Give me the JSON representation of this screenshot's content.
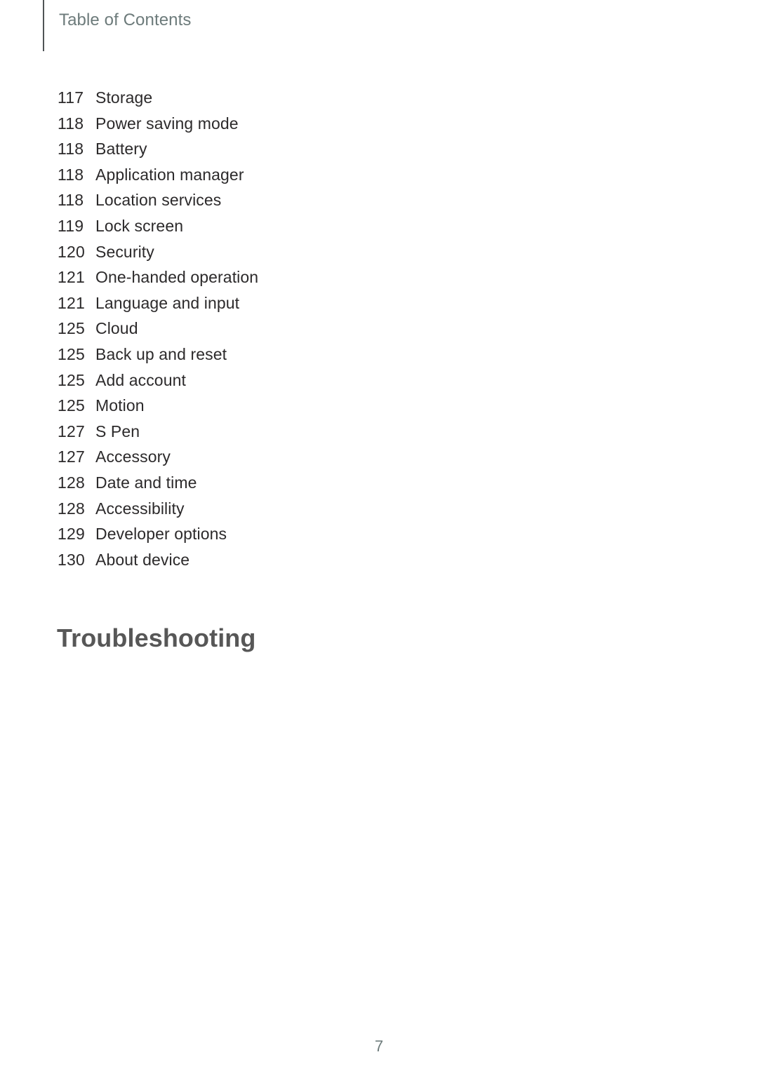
{
  "header": {
    "title": "Table of Contents"
  },
  "toc": {
    "entries": [
      {
        "page": "117",
        "label": "Storage"
      },
      {
        "page": "118",
        "label": "Power saving mode"
      },
      {
        "page": "118",
        "label": "Battery"
      },
      {
        "page": "118",
        "label": "Application manager"
      },
      {
        "page": "118",
        "label": "Location services"
      },
      {
        "page": "119",
        "label": "Lock screen"
      },
      {
        "page": "120",
        "label": "Security"
      },
      {
        "page": "121",
        "label": "One-handed operation"
      },
      {
        "page": "121",
        "label": "Language and input"
      },
      {
        "page": "125",
        "label": "Cloud"
      },
      {
        "page": "125",
        "label": "Back up and reset"
      },
      {
        "page": "125",
        "label": "Add account"
      },
      {
        "page": "125",
        "label": "Motion"
      },
      {
        "page": "127",
        "label": "S Pen"
      },
      {
        "page": "127",
        "label": "Accessory"
      },
      {
        "page": "128",
        "label": "Date and time"
      },
      {
        "page": "128",
        "label": "Accessibility"
      },
      {
        "page": "129",
        "label": "Developer options"
      },
      {
        "page": "130",
        "label": "About device"
      }
    ]
  },
  "chapter": {
    "title": "Troubleshooting"
  },
  "folio": {
    "number": "7"
  },
  "colors": {
    "header_text": "#6d7b7b",
    "header_rule": "#4f5456",
    "body_text": "#2c2a2b",
    "chapter_text": "#575757",
    "folio_text": "#6d7b7b",
    "background": "#ffffff"
  }
}
